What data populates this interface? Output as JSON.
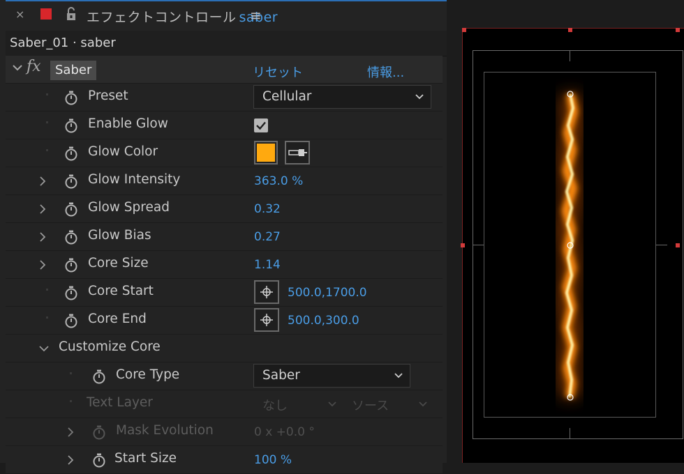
{
  "tab": {
    "title": "エフェクトコントロール",
    "layer": "saber",
    "close_glyph": "×",
    "menu_glyph": "≡"
  },
  "subheader": {
    "text": "Saber_01 · saber"
  },
  "effect": {
    "name": "Saber",
    "reset": "リセット",
    "about": "情報..."
  },
  "params": {
    "preset": {
      "label": "Preset",
      "value": "Cellular"
    },
    "enable_glow": {
      "label": "Enable Glow",
      "checked": true
    },
    "glow_color": {
      "label": "Glow Color",
      "color": "#ffa90f"
    },
    "glow_intensity": {
      "label": "Glow Intensity",
      "value": "363.0 %"
    },
    "glow_spread": {
      "label": "Glow Spread",
      "value": "0.32"
    },
    "glow_bias": {
      "label": "Glow Bias",
      "value": "0.27"
    },
    "core_size": {
      "label": "Core Size",
      "value": "1.14"
    },
    "core_start": {
      "label": "Core Start",
      "value": "500.0,1700.0"
    },
    "core_end": {
      "label": "Core End",
      "value": "500.0,300.0"
    },
    "customize_core": {
      "label": "Customize Core"
    },
    "core_type": {
      "label": "Core Type",
      "value": "Saber"
    },
    "text_layer": {
      "label": "Text Layer",
      "value": "なし",
      "source": "ソース"
    },
    "mask_evolution": {
      "label": "Mask Evolution",
      "value": "0 x +0.0 °"
    },
    "start_size": {
      "label": "Start Size",
      "value": "100 %"
    }
  },
  "colors": {
    "accent_blue": "#4a9de6",
    "tab_label_red": "#d8262b",
    "glow_orange": "#ffa90f",
    "handle_red": "#d23a3a"
  },
  "icons": [
    "close-icon",
    "label-color-icon",
    "lock-icon",
    "menu-icon",
    "fx-icon",
    "stopwatch-icon",
    "chevron-down-icon",
    "checkmark-icon",
    "eyedropper-icon",
    "crosshair-icon",
    "twirl-arrow-icon"
  ]
}
